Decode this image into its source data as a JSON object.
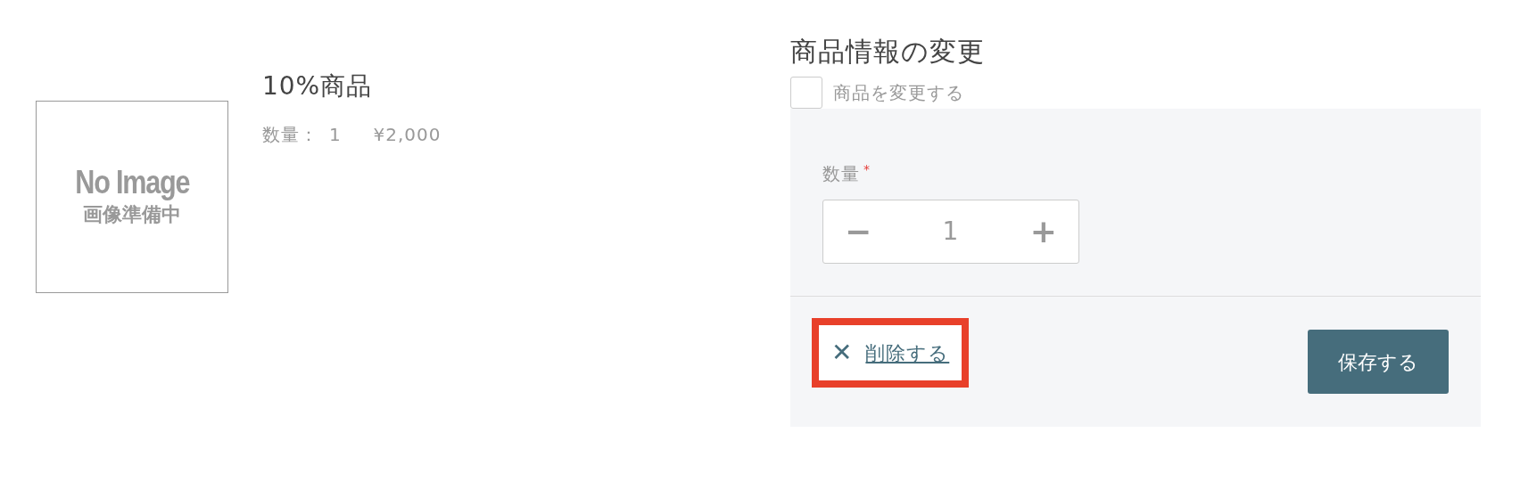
{
  "product": {
    "image_placeholder": {
      "title": "No Image",
      "subtitle": "画像準備中"
    },
    "name": "10%商品",
    "quantity_label": "数量：",
    "quantity": "1",
    "price": "¥2,000"
  },
  "edit_panel": {
    "heading": "商品情報の変更",
    "change_checkbox": {
      "label": "商品を変更する",
      "checked": false
    },
    "quantity_field": {
      "label": "数量",
      "required_mark": "*",
      "minus": "−",
      "value": "1",
      "plus": "+"
    },
    "delete_link": {
      "icon": "✕",
      "label": "削除する",
      "highlighted": true
    },
    "save_button": "保存する"
  }
}
